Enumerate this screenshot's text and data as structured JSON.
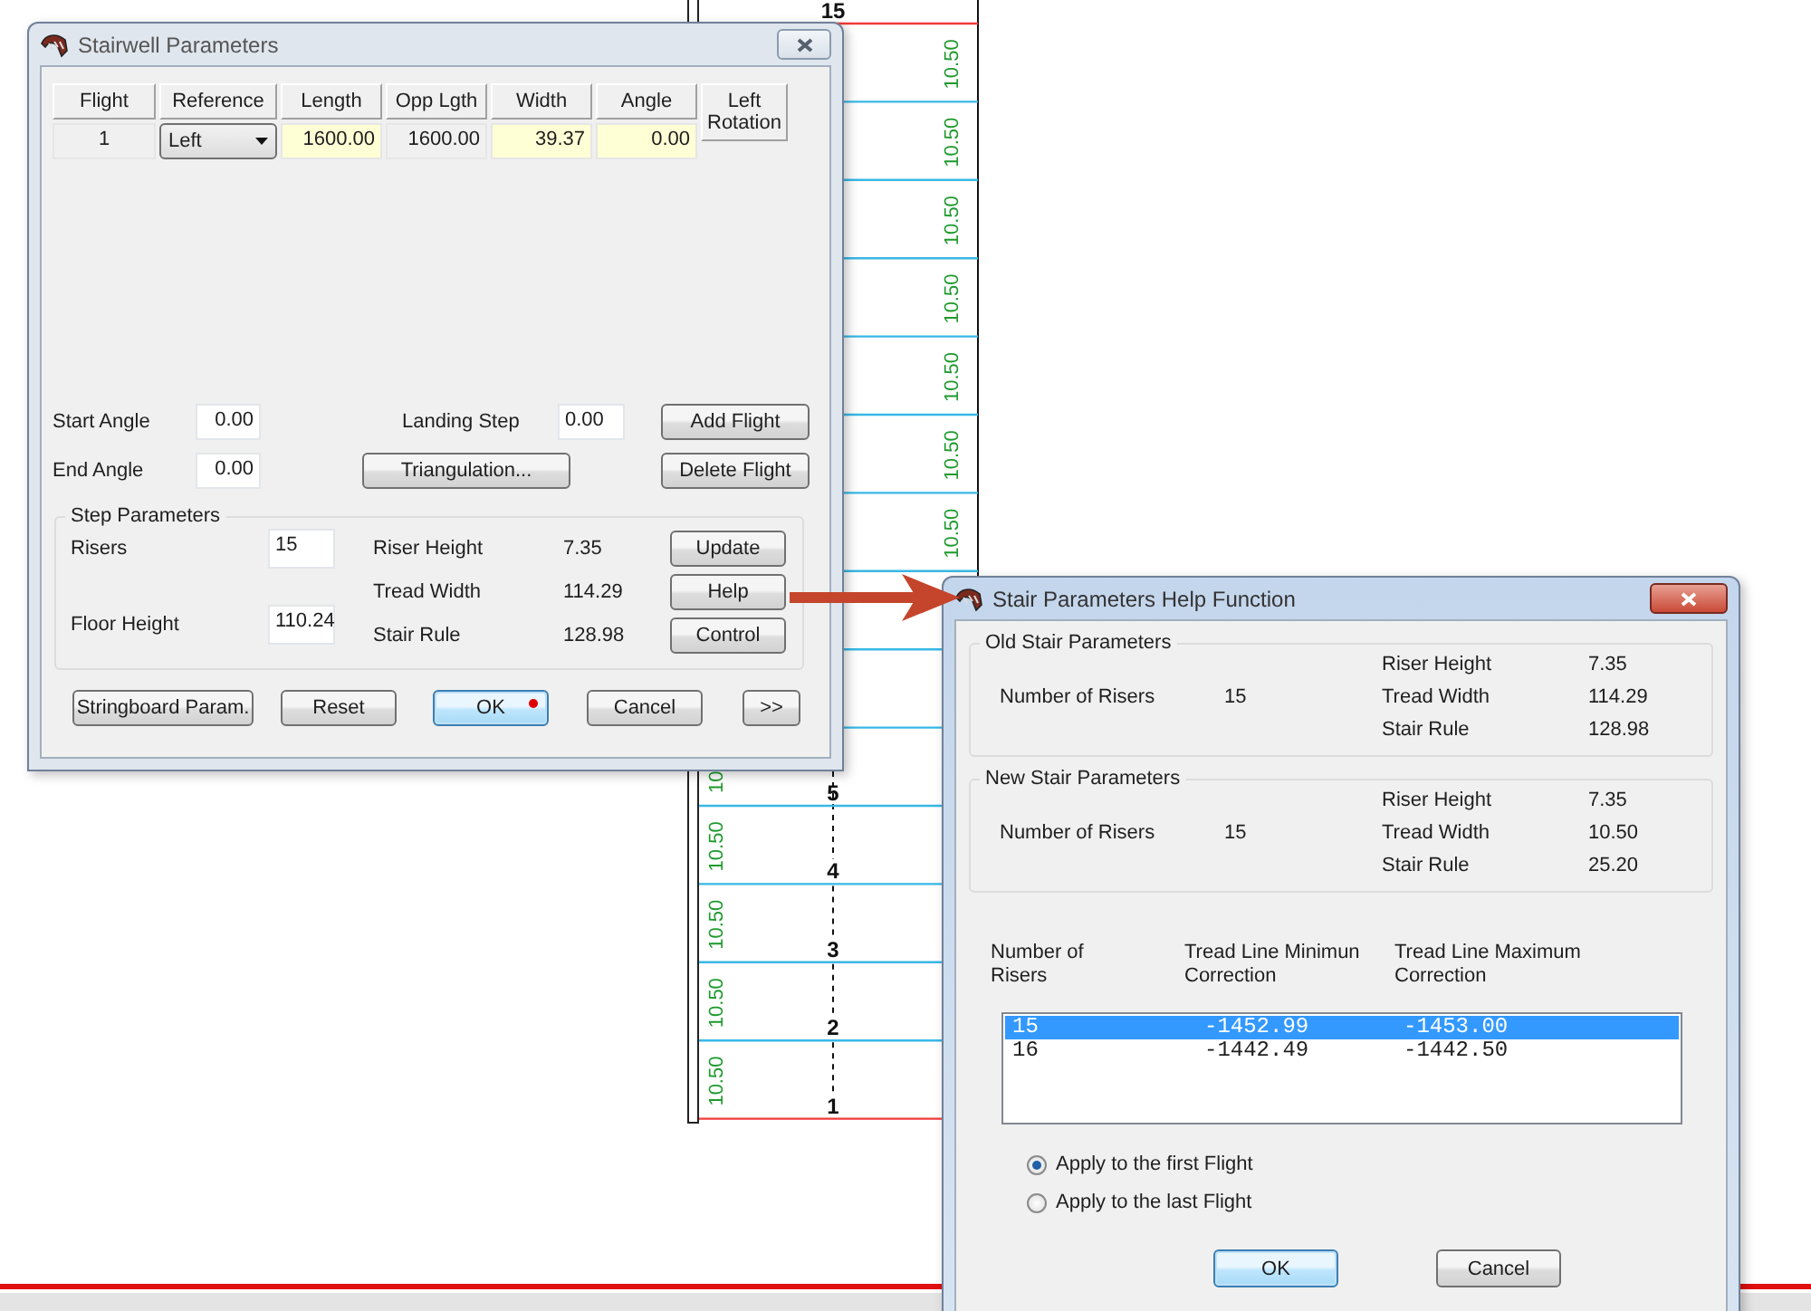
{
  "drawing": {
    "lines": [
      {
        "kind": "boundary",
        "number": "15"
      },
      {
        "kind": "step"
      },
      {
        "kind": "step"
      },
      {
        "kind": "step"
      },
      {
        "kind": "step"
      },
      {
        "kind": "step"
      },
      {
        "kind": "step"
      },
      {
        "kind": "step"
      },
      {
        "kind": "step"
      },
      {
        "kind": "step"
      },
      {
        "kind": "step",
        "number": "5"
      },
      {
        "kind": "step",
        "number": "4"
      },
      {
        "kind": "step",
        "number": "3"
      },
      {
        "kind": "step",
        "number": "2"
      },
      {
        "kind": "boundary",
        "number": "1"
      }
    ],
    "rows": [
      {
        "right_tread": "10.50"
      },
      {
        "right_tread": "10.50"
      },
      {
        "right_tread": "10.50"
      },
      {
        "right_tread": "10.50"
      },
      {
        "right_tread": "10.50"
      },
      {
        "right_tread": "10.50"
      },
      {
        "right_tread": "10.50"
      },
      {},
      {},
      {
        "left_tread": "10"
      },
      {
        "left_tread": "10.50"
      },
      {
        "left_tread": "10.50"
      },
      {
        "left_tread": "10.50"
      },
      {
        "left_tread": "10.50"
      }
    ]
  },
  "stairwell_dialog": {
    "title": "Stairwell Parameters",
    "active": false,
    "columns": [
      "Flight",
      "Reference",
      "Length",
      "Opp Lgth",
      "Width",
      "Angle",
      "Left Rotation"
    ],
    "row": [
      {
        "kind": "cell",
        "value": "1",
        "editable": false
      },
      {
        "kind": "dropdown",
        "value": "Left"
      },
      {
        "kind": "cell",
        "value": "1600.00",
        "editable": true
      },
      {
        "kind": "cell",
        "value": "1600.00",
        "editable": false
      },
      {
        "kind": "cell",
        "value": "39.37",
        "editable": true
      },
      {
        "kind": "cell",
        "value": "0.00",
        "editable": true
      }
    ],
    "start_angle": {
      "label": "Start Angle",
      "value": "0.00"
    },
    "end_angle": {
      "label": "End Angle",
      "value": "0.00"
    },
    "landing_step": {
      "label": "Landing Step",
      "value": "0.00"
    },
    "add_flight": "Add Flight",
    "delete_flight": "Delete Flight",
    "triangulation": "Triangulation...",
    "step_parameters": {
      "title": "Step Parameters",
      "risers": {
        "label": "Risers",
        "value": "15"
      },
      "floor_height": {
        "label": "Floor Height",
        "value": "110.24"
      },
      "results": [
        {
          "label": "Riser Height",
          "value": "7.35"
        },
        {
          "label": "Tread Width",
          "value": "114.29"
        },
        {
          "label": "Stair Rule",
          "value": "128.98"
        }
      ],
      "buttons": [
        "Update",
        "Help",
        "Control"
      ]
    },
    "buttons": [
      {
        "label": "Stringboard Param.",
        "default": false,
        "marked": false
      },
      {
        "label": "Reset",
        "default": false,
        "marked": false
      },
      {
        "label": "OK",
        "default": true,
        "marked": true
      },
      {
        "label": "Cancel",
        "default": false,
        "marked": false
      },
      {
        "label": ">>",
        "default": false,
        "marked": false
      }
    ]
  },
  "help_dialog": {
    "title": "Stair Parameters Help Function",
    "active": true,
    "groups": [
      {
        "title": "Old Stair Parameters",
        "risers_label": "Number of Risers",
        "risers": "15",
        "results": [
          {
            "label": "Riser Height",
            "value": "7.35"
          },
          {
            "label": "Tread Width",
            "value": "114.29"
          },
          {
            "label": "Stair Rule",
            "value": "128.98"
          }
        ]
      },
      {
        "title": "New Stair Parameters",
        "risers_label": "Number of Risers",
        "risers": "15",
        "results": [
          {
            "label": "Riser Height",
            "value": "7.35"
          },
          {
            "label": "Tread Width",
            "value": "10.50"
          },
          {
            "label": "Stair Rule",
            "value": "25.20"
          }
        ]
      }
    ],
    "list_columns": [
      "Number of Risers",
      "Tread Line Minimun Correction",
      "Tread Line Maximum Correction"
    ],
    "list_rows": [
      {
        "cells": [
          "15",
          "-1452.99",
          "-1453.00"
        ],
        "selected": true
      },
      {
        "cells": [
          "16",
          "-1442.49",
          "-1442.50"
        ],
        "selected": false
      }
    ],
    "options": [
      {
        "label": "Apply to the first Flight",
        "selected": true
      },
      {
        "label": "Apply to the last Flight",
        "selected": false
      }
    ],
    "buttons": [
      {
        "label": "OK",
        "default": true
      },
      {
        "label": "Cancel",
        "default": false
      }
    ]
  }
}
